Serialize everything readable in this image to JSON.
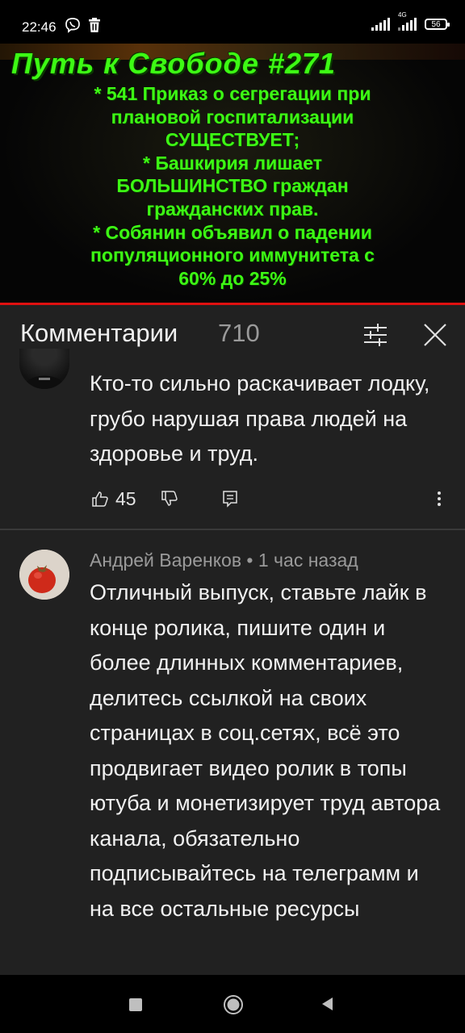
{
  "status_bar": {
    "time": "22:46",
    "network_label": "4G",
    "battery": "56"
  },
  "video": {
    "title": "Путь к Свободе #271",
    "lines": [
      "* 541 Приказ о сегрегации при",
      "плановой госпитализации",
      "СУЩЕСТВУЕТ;",
      "* Башкирия лишает",
      "БОЛЬШИНСТВО граждан",
      "гражданских прав.",
      "* Собянин объявил о падении",
      "популяционного иммунитета с",
      "60% до 25%"
    ]
  },
  "comments_panel": {
    "title": "Комментарии",
    "count": "710"
  },
  "comments": [
    {
      "text": "Кто-то сильно раскачивает лодку, грубо нарушая права людей на здоровье и труд.",
      "likes": "45"
    },
    {
      "meta": "Андрей Варенков • 1 час назад",
      "text": "Отличный выпуск, ставьте лайк в конце ролика, пишите один и более длинных комментариев, делитесь ссылкой на своих страницах в соц.сетях, всё это продвигает видео ролик в топы ютуба и монетизирует труд автора канала, обязательно подписывайтесь на телеграмм и на все остальные ресурсы"
    }
  ],
  "colors": {
    "background": "#212121",
    "video_text": "#3dfa14",
    "progress": "#e01010",
    "muted_text": "#9a9a9a"
  },
  "icons": [
    "viber-icon",
    "trash-icon",
    "signal-icon",
    "battery-icon",
    "filter-icon",
    "close-icon",
    "thumbs-up-icon",
    "thumbs-down-icon",
    "reply-icon",
    "more-vert-icon",
    "nav-recents-icon",
    "nav-home-icon",
    "nav-back-icon"
  ]
}
